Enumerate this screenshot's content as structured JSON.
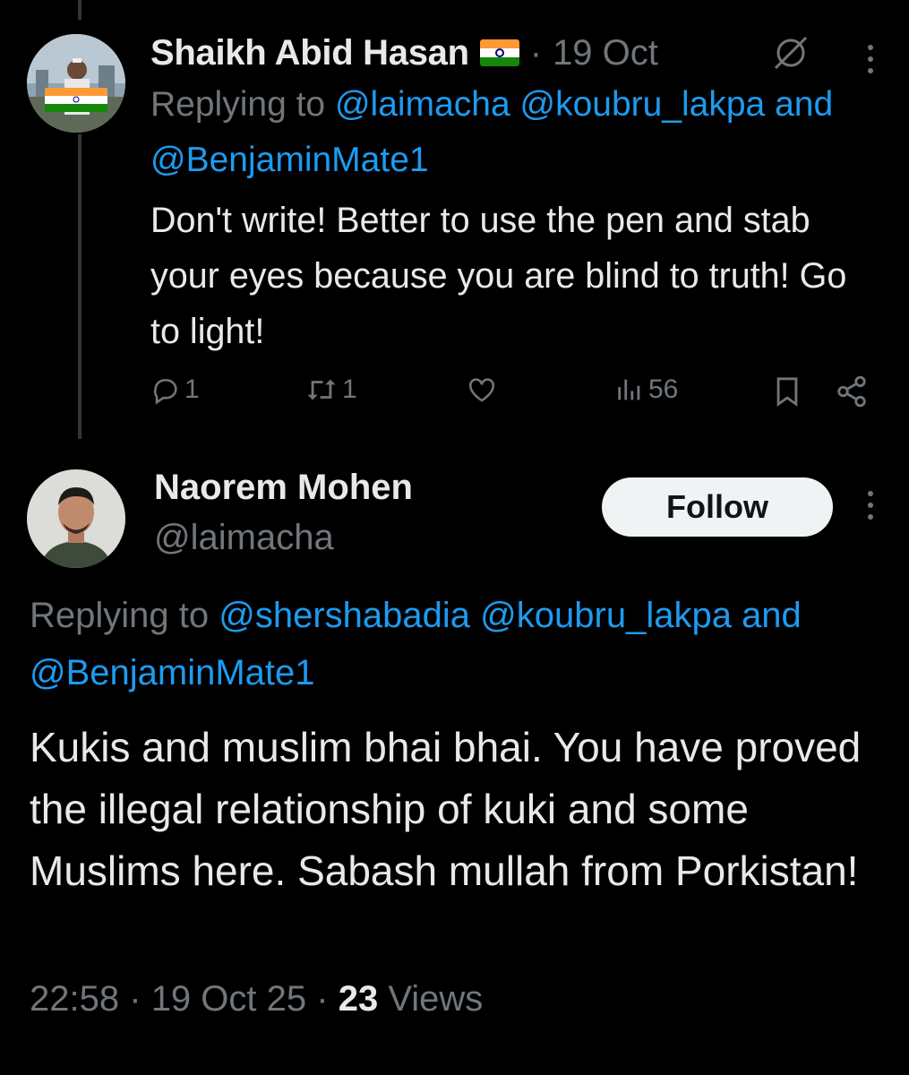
{
  "tweet1": {
    "author_name": "Shaikh Abid Hasan",
    "flag_icon": "india-flag-icon",
    "separator": "·",
    "date": "19 Oct",
    "replying_prefix": "Replying to",
    "mentions": [
      "@laimacha",
      "@koubru_lakpa"
    ],
    "and_word": "and",
    "last_mention": "@BenjaminMate1",
    "text": "Don't write! Better to use the pen and stab your eyes because you are blind to truth! Go to light!",
    "reply_count": "1",
    "retweet_count": "1",
    "views_count": "56"
  },
  "tweet2": {
    "author_name": "Naorem Mohen",
    "handle": "@laimacha",
    "follow_label": "Follow",
    "replying_prefix": "Replying to",
    "mentions": [
      "@shershabadia",
      "@koubru_lakpa"
    ],
    "and_word": "and",
    "last_mention": "@BenjaminMate1",
    "text": "Kukis and muslim bhai bhai. You have proved the illegal relationship of kuki and some Muslims here. Sabash mullah from Porkistan!",
    "time": "22:58",
    "date": "19 Oct 25",
    "separator": "·",
    "views_count": "23",
    "views_label": "Views"
  },
  "colors": {
    "background": "#000000",
    "text": "#e7e9ea",
    "secondary": "#71767b",
    "link": "#1d9bf0",
    "follow_bg": "#eff3f4"
  }
}
